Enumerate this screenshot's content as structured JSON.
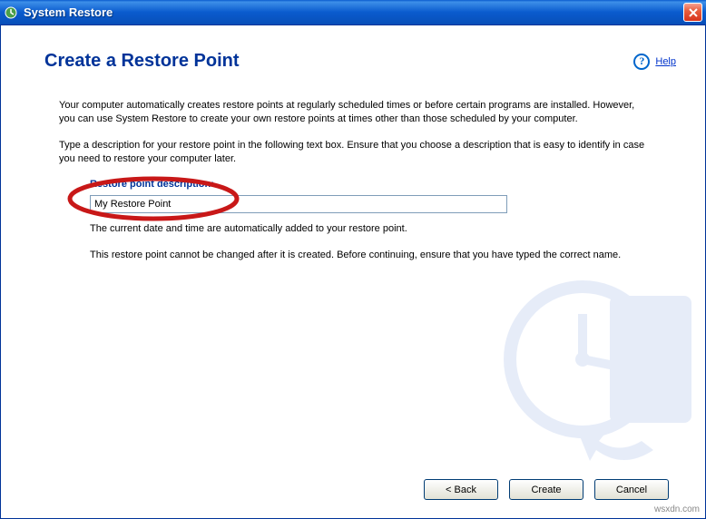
{
  "titlebar": {
    "title": "System Restore"
  },
  "header": {
    "page_title": "Create a Restore Point",
    "help_label": "Help"
  },
  "content": {
    "para1": "Your computer automatically creates restore points at regularly scheduled times or before certain programs are installed. However, you can use System Restore to create your own restore points at times other than those scheduled by your computer.",
    "para2": "Type a description for your restore point in the following text box. Ensure that you choose a description that is easy to identify in case you need to restore your computer later.",
    "input_label": "Restore point description:",
    "input_value": "My Restore Point",
    "note1": "The current date and time are automatically added to your restore point.",
    "note2": "This restore point cannot be changed after it is created. Before continuing, ensure that you have typed the correct name."
  },
  "buttons": {
    "back": "<  Back",
    "create": "Create",
    "cancel": "Cancel"
  },
  "watermark_url": "wsxdn.com"
}
